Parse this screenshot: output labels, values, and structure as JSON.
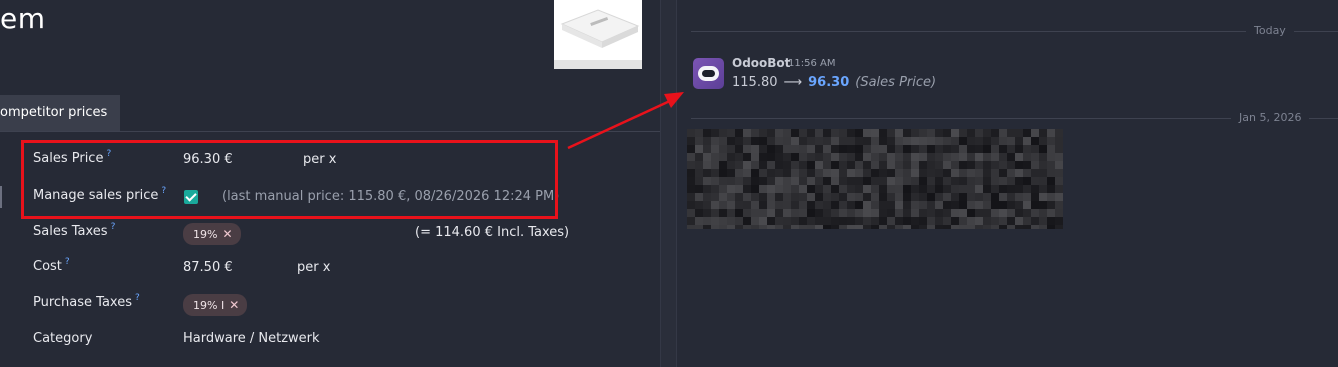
{
  "form": {
    "title": "em",
    "tab_label": "ompetitor prices",
    "fields": {
      "sales_price": {
        "label": "Sales Price",
        "help": "?",
        "value": "96.30 €",
        "unit": "per x"
      },
      "manage_sales_price": {
        "label": "Manage sales price",
        "help": "?",
        "checked": true,
        "note": "(last manual price: 115.80 €, 08/26/2026 12:24 PM)"
      },
      "sales_taxes": {
        "label": "Sales Taxes",
        "help": "?",
        "tag": "19%",
        "tag_remove": "✕",
        "incl_taxes": "(= 114.60 € Incl. Taxes)"
      },
      "cost": {
        "label": "Cost",
        "help": "?",
        "value": "87.50 €",
        "unit": "per x"
      },
      "purchase_taxes": {
        "label": "Purchase Taxes",
        "help": "?",
        "tag": "19% I",
        "tag_remove": "✕"
      },
      "category": {
        "label": "Category",
        "value": "Hardware / Netzwerk"
      }
    }
  },
  "chatter": {
    "separator_today": "Today",
    "separator_older": "Jan 5, 2026",
    "message": {
      "author": "OdooBot",
      "time": "11:56 AM",
      "old_value": "115.80",
      "arrow": "⟶",
      "new_value": "96.30",
      "field": "(Sales Price)"
    }
  },
  "colors": {
    "background": "#262a36",
    "highlight": "#e8121b",
    "accent_link": "#6aa6ff",
    "checkbox": "#1aa99b",
    "tag_bg": "#4a3d44"
  },
  "icons": {
    "avatar": "odoobot-avatar-icon",
    "check": "checkmark-icon",
    "remove_tag": "close-icon"
  }
}
